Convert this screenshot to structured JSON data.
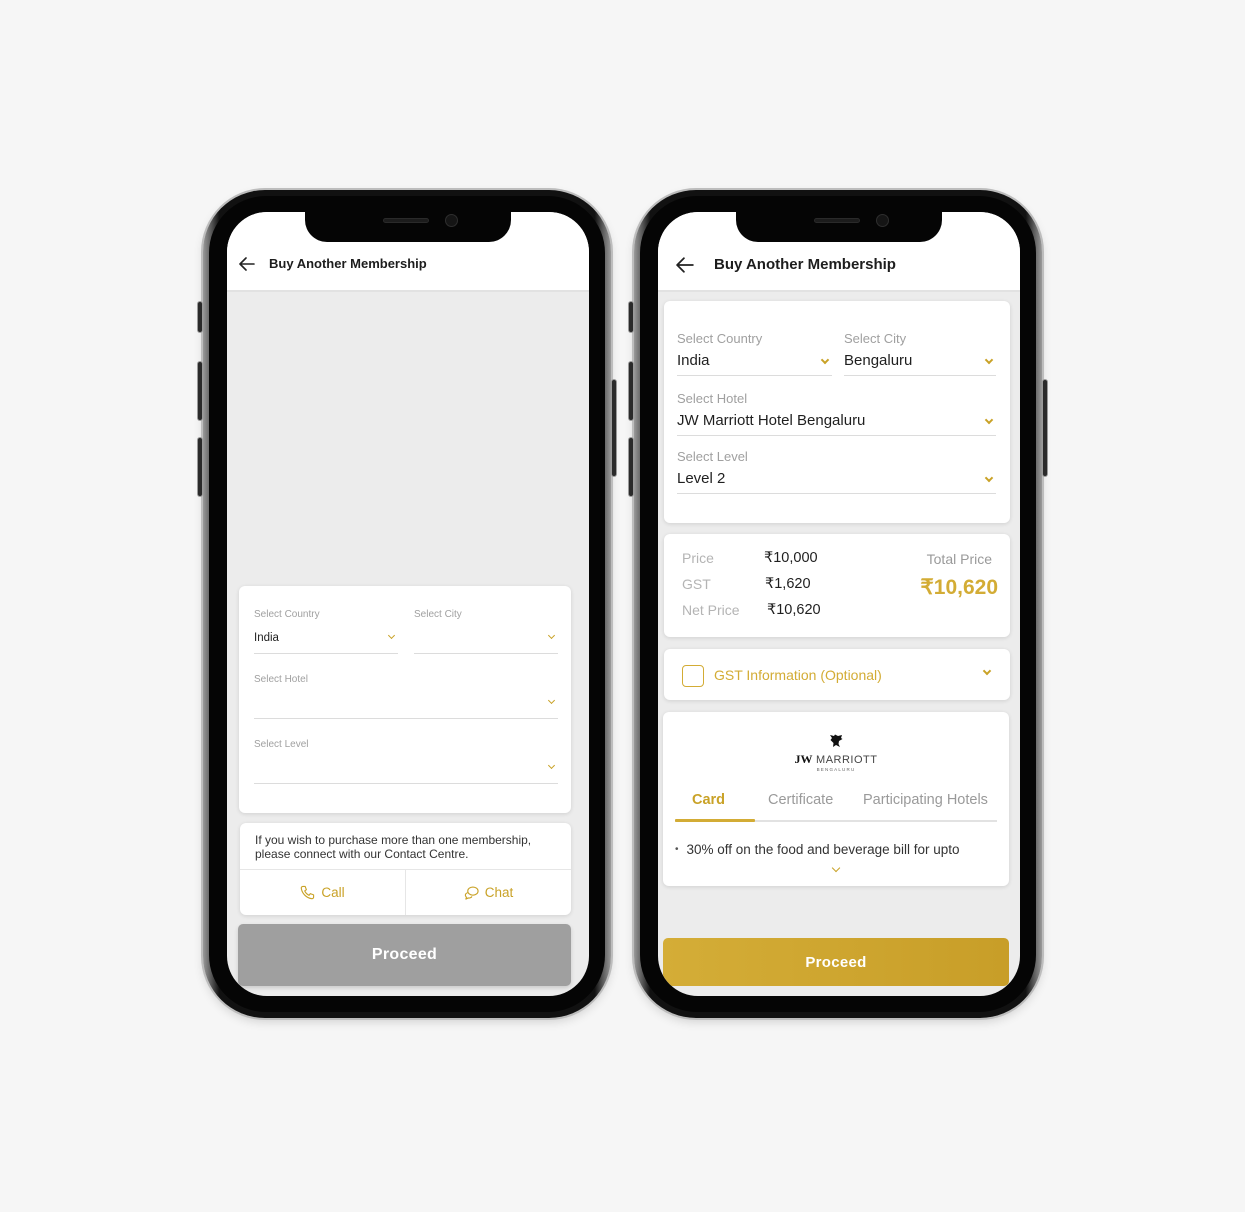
{
  "colors": {
    "accent_gold": "#c9a227",
    "disabled_button": "#9f9f9f",
    "background": "#f6f6f6"
  },
  "left_phone": {
    "header": {
      "title": "Buy Another Membership",
      "back_icon": "arrow-left-icon"
    },
    "form": {
      "country": {
        "label": "Select Country",
        "value": "India"
      },
      "city": {
        "label": "Select City",
        "value": ""
      },
      "hotel": {
        "label": "Select Hotel",
        "value": ""
      },
      "level": {
        "label": "Select Level",
        "value": ""
      }
    },
    "contact": {
      "message": "If you wish to purchase more than one membership, please connect with our Contact Centre.",
      "call_label": "Call",
      "call_icon": "phone-icon",
      "chat_label": "Chat",
      "chat_icon": "chat-bubbles-icon"
    },
    "proceed_label": "Proceed",
    "proceed_state": "disabled"
  },
  "right_phone": {
    "header": {
      "title": "Buy Another Membership",
      "back_icon": "arrow-left-icon"
    },
    "form": {
      "country": {
        "label": "Select Country",
        "value": "India"
      },
      "city": {
        "label": "Select City",
        "value": "Bengaluru"
      },
      "hotel": {
        "label": "Select Hotel",
        "value": "JW Marriott Hotel Bengaluru"
      },
      "level": {
        "label": "Select Level",
        "value": "Level 2"
      }
    },
    "pricing": {
      "rows": [
        {
          "label": "Price",
          "value": "₹10,000"
        },
        {
          "label": "GST",
          "value": "₹1,620"
        },
        {
          "label": "Net Price",
          "value": "₹10,620"
        }
      ],
      "total_label": "Total Price",
      "total_value": "₹10,620"
    },
    "gst_info": {
      "label": "GST Information (Optional)",
      "checked": false
    },
    "hotel_card": {
      "logo_brand": "JW",
      "logo_name": "MARRIOTT",
      "logo_location": "BENGALURU",
      "tabs": [
        {
          "label": "Card",
          "active": true
        },
        {
          "label": "Certificate",
          "active": false
        },
        {
          "label": "Participating Hotels",
          "active": false
        }
      ],
      "benefit": "30% off on the food and beverage bill for upto"
    },
    "proceed_label": "Proceed",
    "proceed_state": "enabled"
  }
}
